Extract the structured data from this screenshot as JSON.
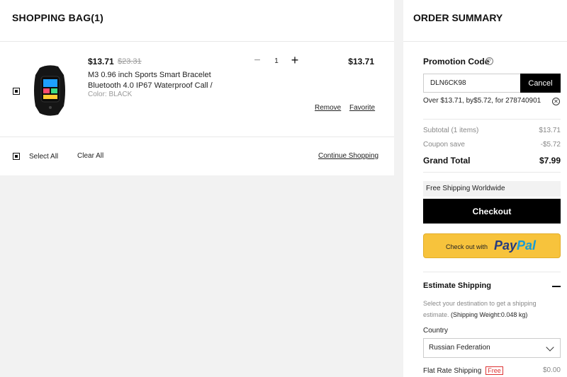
{
  "cart": {
    "title": "SHOPPING BAG(1)",
    "item": {
      "price": "$13.71",
      "old_price": "$23.31",
      "name": "M3 0.96 inch Sports Smart Bracelet Bluetooth 4.0 IP67 Waterproof Call /",
      "color": "Color: BLACK",
      "quantity": "1",
      "minus": "−",
      "plus": "+",
      "total": "$13.71",
      "remove": "Remove",
      "favorite": "Favorite",
      "selected": true
    },
    "select_all": "Select All",
    "clear_all": "Clear All",
    "continue_shopping": "Continue Shopping"
  },
  "summary": {
    "title": "ORDER SUMMARY",
    "promo_label": "Promotion Code",
    "promo_value": "DLN6CK98",
    "promo_cancel": "Cancel",
    "promo_message": "Over $13.71, by$5.72, for 278740901",
    "subtotal_label": "Subtotal (1 items)",
    "subtotal_value": "$13.71",
    "coupon_label": "Coupon save",
    "coupon_value": "-$5.72",
    "grand_label": "Grand Total",
    "grand_value": "$7.99",
    "free_shipping": "Free Shipping Worldwide",
    "checkout": "Checkout",
    "paypal_lead": "Check out with",
    "paypal_logo_a": "Pay",
    "paypal_logo_b": "Pal",
    "estimate_title": "Estimate Shipping",
    "estimate_desc": "Select your destination to get a shipping estimate.",
    "estimate_weight": "(Shipping Weight:0.048 kg)",
    "country_label": "Country",
    "country_value": "Russian Federation",
    "flat_rate_label": "Flat Rate Shipping",
    "flat_rate_badge": "Free",
    "flat_rate_value": "$0.00"
  },
  "colors": {
    "paypal_yellow": "#f7c33c",
    "paypal_dark_blue": "#253b80",
    "paypal_light_blue": "#179bd7",
    "button_black": "#000000"
  },
  "icons": [
    "help-icon",
    "close-circle-icon",
    "minus-icon",
    "plus-icon",
    "chevron-down-icon",
    "collapse-icon"
  ]
}
